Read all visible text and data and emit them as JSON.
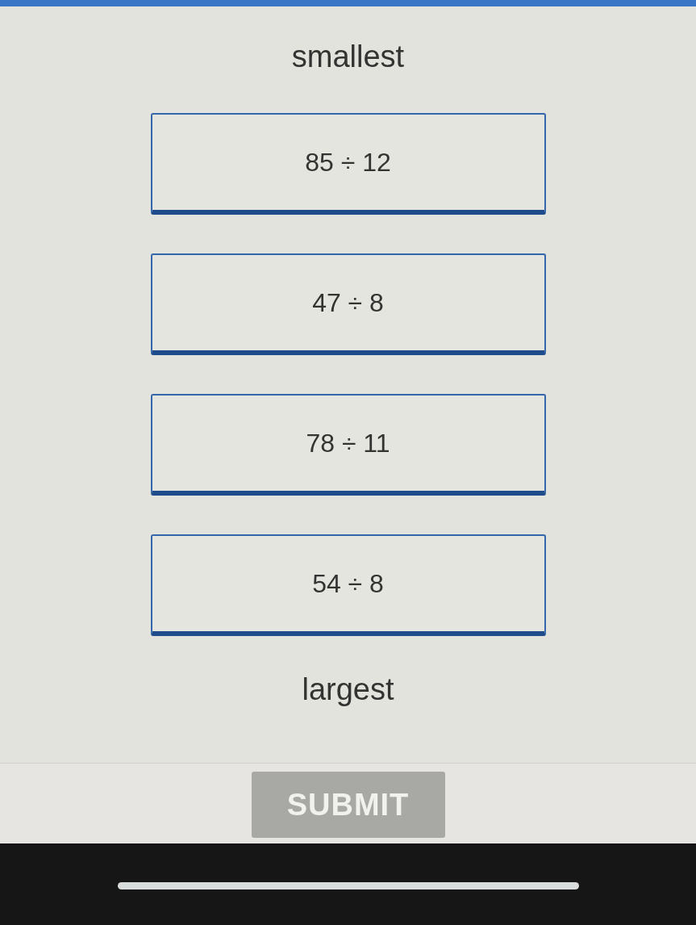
{
  "order_labels": {
    "top": "smallest",
    "bottom": "largest"
  },
  "cards": [
    {
      "expression": "85 ÷ 12"
    },
    {
      "expression": "47 ÷ 8"
    },
    {
      "expression": "78 ÷ 11"
    },
    {
      "expression": "54 ÷ 8"
    }
  ],
  "submit": {
    "label": "SUBMIT",
    "disabled": true
  }
}
